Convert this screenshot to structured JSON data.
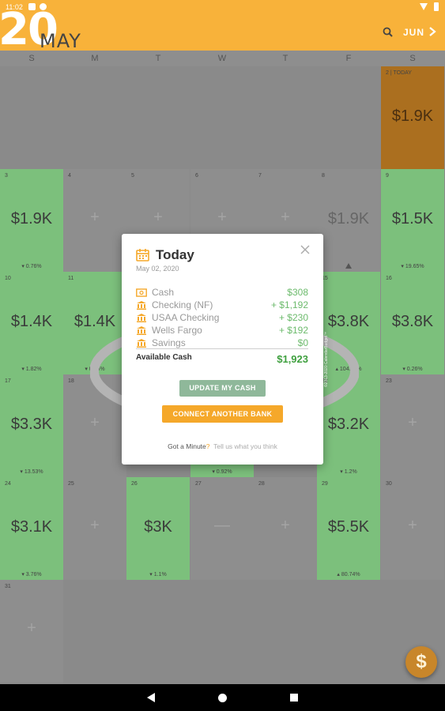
{
  "status": {
    "time": "11:02"
  },
  "header": {
    "year_short": "20",
    "month": "MAY",
    "next_month": "JUN"
  },
  "weekdays": [
    "S",
    "M",
    "T",
    "W",
    "T",
    "F",
    "S"
  ],
  "calendar": {
    "today_label": "2 | TODAY",
    "today_amount": "$1.9K",
    "cells": {
      "d3": {
        "num": "3",
        "amount": "$1.9K",
        "pct": "▾ 0.76%"
      },
      "d4": {
        "num": "4",
        "plus": "+"
      },
      "d5": {
        "num": "5",
        "plus": "+"
      },
      "d6": {
        "num": "6",
        "plus": "+"
      },
      "d7": {
        "num": "7",
        "plus": "+"
      },
      "d8": {
        "num": "8",
        "amount": "$1.9K"
      },
      "d9": {
        "num": "9",
        "amount": "$1.5K",
        "pct": "▾ 19.65%"
      },
      "d10": {
        "num": "10",
        "amount": "$1.4K",
        "pct": "▾ 1.82%"
      },
      "d11": {
        "num": "11",
        "amount": "$1.4K",
        "pct": "▾ 0.15%"
      },
      "d15": {
        "num": "15",
        "amount": "$3.8K",
        "pct": "▴ 104.79%"
      },
      "d16": {
        "num": "16",
        "amount": "$3.8K",
        "pct": "▾ 0.26%"
      },
      "d17": {
        "num": "17",
        "amount": "$3.3K",
        "pct": "▾ 13.53%"
      },
      "d18": {
        "num": "18",
        "plus": "+"
      },
      "d22": {
        "num": "22",
        "amount": "$3.2K",
        "pct": "▾ 1.2%"
      },
      "d23": {
        "num": "23",
        "plus": "+"
      },
      "d24": {
        "num": "24",
        "amount": "$3.1K",
        "pct": "▾ 3.76%"
      },
      "d25": {
        "num": "25",
        "plus": "+"
      },
      "d26": {
        "num": "26",
        "amount": "$3K",
        "pct": "▾ 1.1%"
      },
      "d27": {
        "num": "27",
        "plus": "—"
      },
      "d28": {
        "num": "28",
        "plus": "+"
      },
      "d29": {
        "num": "29",
        "amount": "$5.5K",
        "pct": "▴ 80.74%"
      },
      "d30": {
        "num": "30",
        "plus": "+"
      },
      "d31": {
        "num": "31",
        "plus": "+"
      },
      "d20_pct": "▾ 0.92%"
    }
  },
  "modal": {
    "title": "Today",
    "date": "May 02, 2020",
    "accounts": [
      {
        "name": "Cash",
        "value": "$308",
        "icon": "cash-icon"
      },
      {
        "name": "Checking (NF)",
        "value": "+ $1,192",
        "icon": "bank-icon"
      },
      {
        "name": "USAA Checking",
        "value": "+ $230",
        "icon": "bank-icon"
      },
      {
        "name": "Wells Fargo",
        "value": "+ $192",
        "icon": "bank-icon"
      },
      {
        "name": "Savings",
        "value": "$0",
        "icon": "bank-icon"
      }
    ],
    "available_label": "Available Cash",
    "available_value": "$1,923",
    "update_button": "UPDATE MY CASH",
    "connect_button": "CONNECT ANOTHER BANK",
    "feedback_prefix": "Got a Minute",
    "feedback_q": "?",
    "feedback_link": "Tell us what you think",
    "copyright": "©2013-2020 CalendarBudget™"
  },
  "fab": {
    "label": "$"
  },
  "colors": {
    "accent": "#f8b23a",
    "green": "#6dbb6d",
    "update_btn": "#8fb89a",
    "connect_btn": "#f5a82a"
  }
}
